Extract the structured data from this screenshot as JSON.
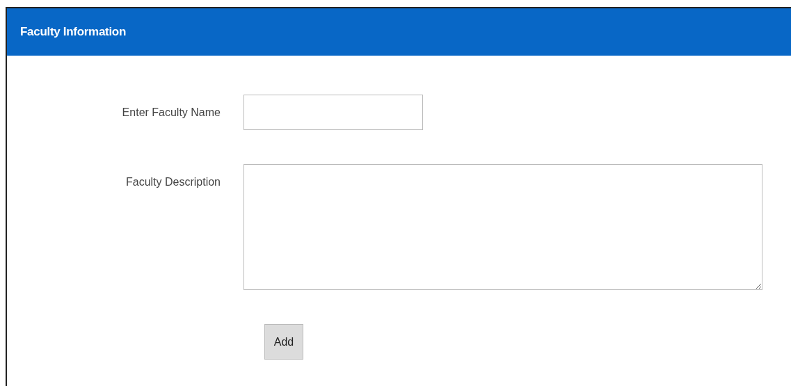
{
  "panel": {
    "title": "Faculty Information"
  },
  "fields": [
    {
      "kind": "text",
      "label": "Enter Faculty Name"
    },
    {
      "kind": "textarea",
      "label": "Faculty Description"
    }
  ],
  "buttons": [
    "Add"
  ]
}
